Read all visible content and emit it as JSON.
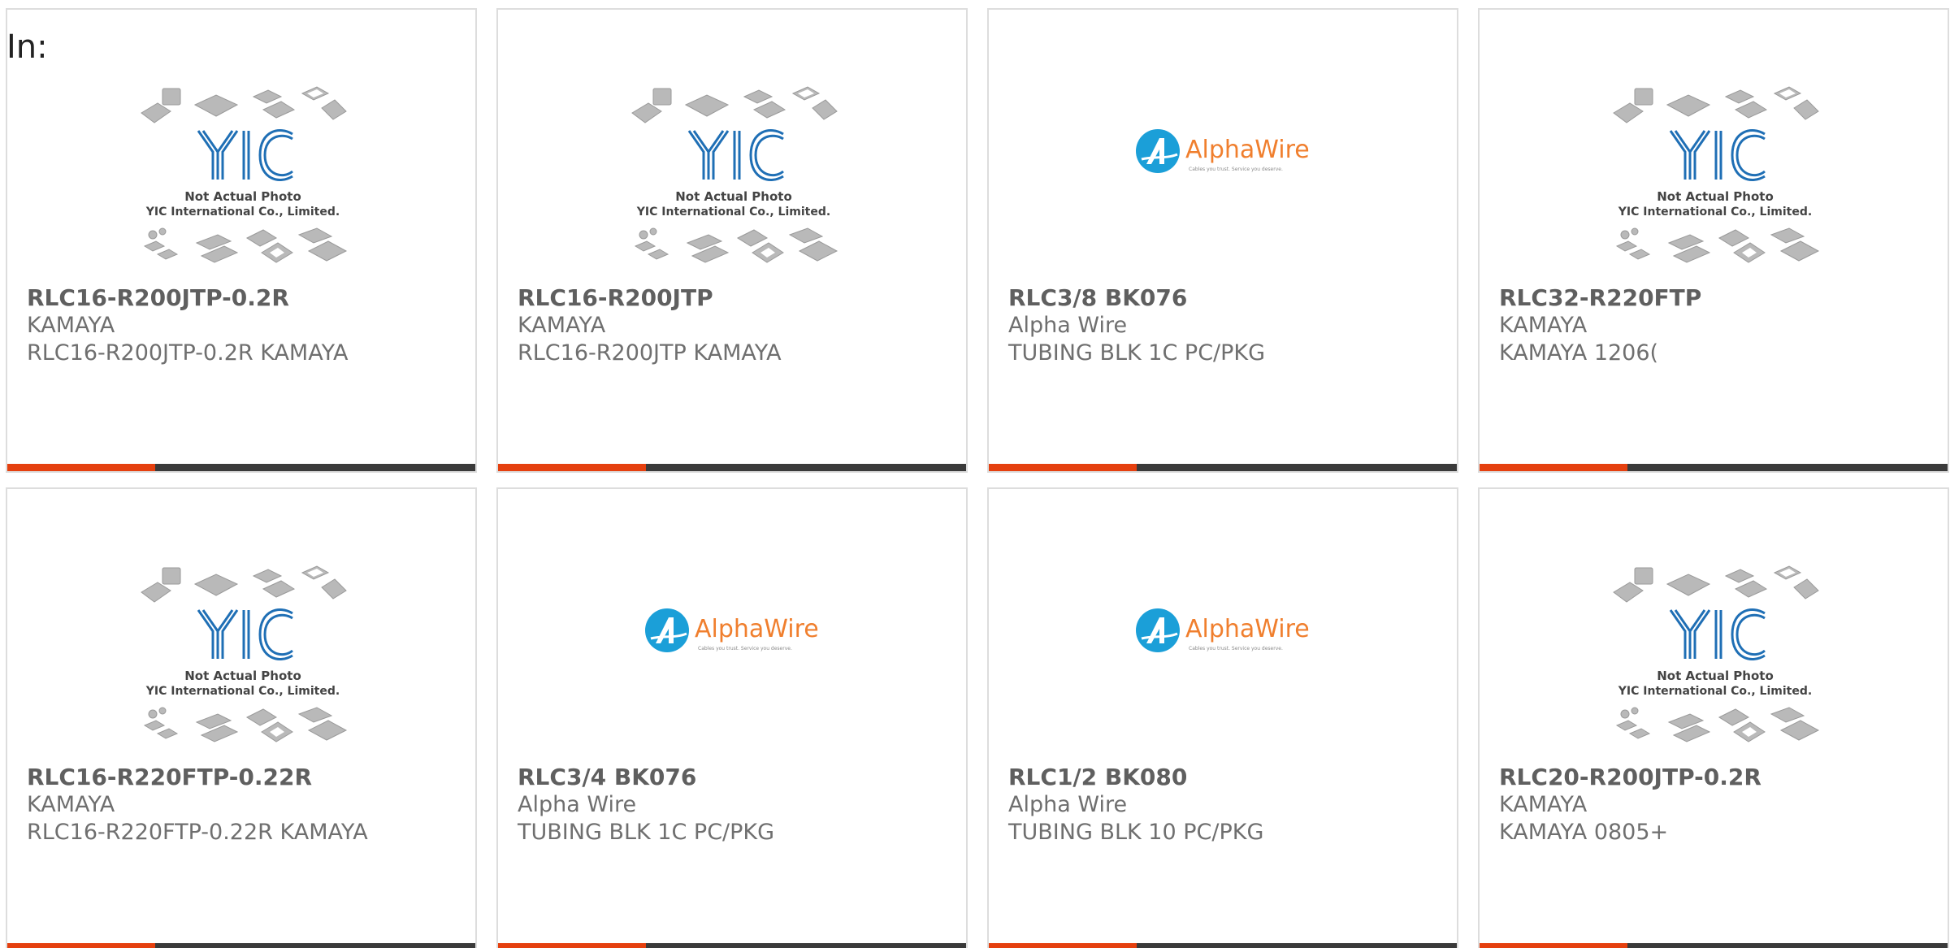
{
  "filter": {
    "label": "In:"
  },
  "placeholder_image": {
    "caption_line1": "Not Actual Photo",
    "caption_line2": "YIC International Co., Limited.",
    "logo_text": "YIC"
  },
  "alphawire_logo": {
    "brand": "AlphaWire",
    "tagline": "Cables you trust. Service you deserve."
  },
  "colors": {
    "accent": "#e5400f",
    "bar": "#3a3a3a",
    "yic_blue": "#1f6fb5",
    "alpha_blue": "#1b9fd8",
    "alpha_orange": "#f07f2e"
  },
  "products": [
    {
      "part_number": "RLC16-R200JTP-0.2R",
      "manufacturer": "KAMAYA",
      "description": "RLC16-R200JTP-0.2R KAMAYA",
      "image": "yic-placeholder"
    },
    {
      "part_number": "RLC16-R200JTP",
      "manufacturer": "KAMAYA",
      "description": "RLC16-R200JTP KAMAYA",
      "image": "yic-placeholder"
    },
    {
      "part_number": "RLC3/8 BK076",
      "manufacturer": "Alpha Wire",
      "description": "TUBING BLK 1C PC/PKG",
      "image": "alphawire-logo"
    },
    {
      "part_number": "RLC32-R220FTP",
      "manufacturer": "KAMAYA",
      "description": "KAMAYA 1206(",
      "image": "yic-placeholder"
    },
    {
      "part_number": "RLC16-R220FTP-0.22R",
      "manufacturer": "KAMAYA",
      "description": "RLC16-R220FTP-0.22R KAMAYA",
      "image": "yic-placeholder"
    },
    {
      "part_number": "RLC3/4 BK076",
      "manufacturer": "Alpha Wire",
      "description": "TUBING BLK 1C PC/PKG",
      "image": "alphawire-logo"
    },
    {
      "part_number": "RLC1/2 BK080",
      "manufacturer": "Alpha Wire",
      "description": "TUBING BLK 10 PC/PKG",
      "image": "alphawire-logo"
    },
    {
      "part_number": "RLC20-R200JTP-0.2R",
      "manufacturer": "KAMAYA",
      "description": "KAMAYA 0805+",
      "image": "yic-placeholder"
    }
  ]
}
